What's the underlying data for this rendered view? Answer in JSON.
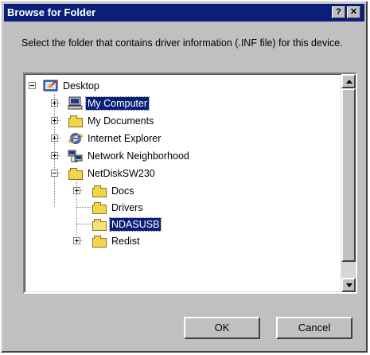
{
  "window": {
    "title": "Browse for Folder",
    "help_glyph": "?",
    "close_glyph": "✕"
  },
  "description": "Select the folder that contains driver information (.INF file) for this device.",
  "tree": {
    "items": [
      {
        "label": "Desktop",
        "icon": "desktop-icon",
        "expander": "minus",
        "selected": false
      },
      {
        "label": "My Computer",
        "icon": "computer-icon",
        "expander": "plus",
        "selected": true
      },
      {
        "label": "My Documents",
        "icon": "documents-folder-icon",
        "expander": "plus",
        "selected": false
      },
      {
        "label": "Internet Explorer",
        "icon": "internet-explorer-icon",
        "expander": "plus",
        "selected": false
      },
      {
        "label": "Network Neighborhood",
        "icon": "network-icon",
        "expander": "plus",
        "selected": false
      },
      {
        "label": "NetDiskSW230",
        "icon": "folder-icon",
        "expander": "minus",
        "selected": false
      },
      {
        "label": "Docs",
        "icon": "folder-icon",
        "expander": "plus",
        "selected": false
      },
      {
        "label": "Drivers",
        "icon": "folder-icon",
        "expander": "none",
        "selected": false
      },
      {
        "label": "NDASUSB",
        "icon": "folder-open-icon",
        "expander": "none",
        "selected": true
      },
      {
        "label": "Redist",
        "icon": "folder-icon",
        "expander": "plus",
        "selected": false
      }
    ]
  },
  "buttons": {
    "ok": "OK",
    "cancel": "Cancel"
  },
  "colors": {
    "titlebar": "#0a1f7a",
    "selection": "#0a1f7a",
    "face": "#c0c0c0"
  }
}
